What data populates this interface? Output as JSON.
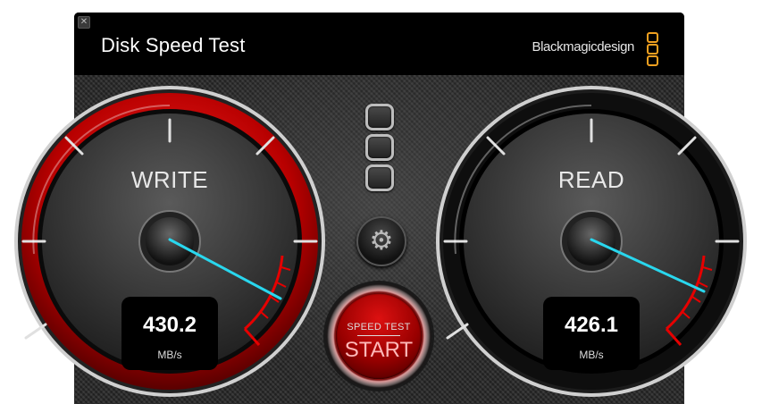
{
  "window": {
    "title": "Disk Speed Test",
    "close_glyph": "✕",
    "brand_name": "Blackmagicdesign",
    "brand_logo_icon": "blackmagic-logo-icon"
  },
  "write": {
    "label": "WRITE",
    "value": "430.2",
    "unit": "MB/s",
    "ring_color": "#c30000"
  },
  "read": {
    "label": "READ",
    "value": "426.1",
    "unit": "MB/s",
    "ring_color": "#1a1a1a"
  },
  "settings": {
    "icon": "gear-icon",
    "glyph": "⚙"
  },
  "start": {
    "top_label": "SPEED TEST",
    "label": "START",
    "accent_color": "#e00000"
  },
  "colors": {
    "needle": "#29d7ee",
    "redline": "#e60000",
    "brand_logo": "#f0a020"
  }
}
